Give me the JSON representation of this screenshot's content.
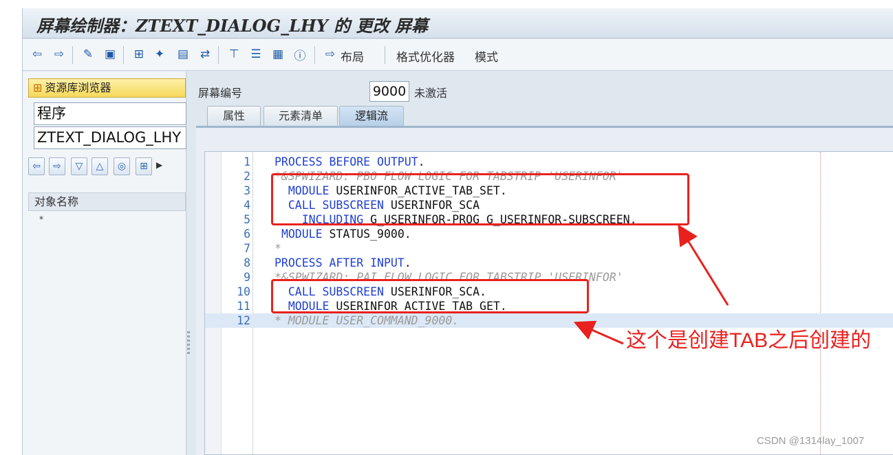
{
  "window": {
    "title": "屏幕绘制器：ZTEXT_DIALOG_LHY 的 更改 屏幕"
  },
  "toolbar": {
    "back_icon": "arrow-left-icon",
    "forward_icon": "arrow-right-icon",
    "layout_label": "布局",
    "format_optimizer_label": "格式优化器",
    "mode_label": "模式"
  },
  "left_pane": {
    "repo_browser_label": "资源库浏览器",
    "object_type": "程序",
    "object_name": "ZTEXT_DIALOG_LHY",
    "object_name_header": "对象名称",
    "tree_placeholder": "*"
  },
  "screen": {
    "number_label": "屏幕编号",
    "number_value": "9000",
    "status": "未激活"
  },
  "tabs": [
    {
      "label": "属性"
    },
    {
      "label": "元素清单"
    },
    {
      "label": "逻辑流"
    }
  ],
  "active_tab": "逻辑流",
  "code": {
    "lines": [
      {
        "n": "1",
        "parts": [
          [
            "kw",
            "PROCESS BEFORE OUTPUT"
          ],
          [
            "pl",
            "."
          ]
        ]
      },
      {
        "n": "2",
        "parts": [
          [
            "cm",
            "*&SPWIZARD: PBO FLOW LOGIC FOR TABSTRIP 'USERINFOR'"
          ]
        ]
      },
      {
        "n": "3",
        "parts": [
          [
            "pl",
            "  "
          ],
          [
            "kw",
            "MODULE"
          ],
          [
            "pl",
            " USERINFOR_ACTIVE_TAB_SET."
          ]
        ]
      },
      {
        "n": "4",
        "parts": [
          [
            "pl",
            "  "
          ],
          [
            "kw",
            "CALL SUBSCREEN"
          ],
          [
            "pl",
            " USERINFOR_SCA"
          ]
        ]
      },
      {
        "n": "5",
        "parts": [
          [
            "pl",
            "    "
          ],
          [
            "kw",
            "INCLUDING"
          ],
          [
            "pl",
            " G_USERINFOR-PROG G_USERINFOR-SUBSCREEN."
          ]
        ]
      },
      {
        "n": "6",
        "parts": [
          [
            "pl",
            " "
          ],
          [
            "kw",
            "MODULE"
          ],
          [
            "pl",
            " STATUS_9000."
          ]
        ]
      },
      {
        "n": "7",
        "parts": [
          [
            "cm",
            "*"
          ]
        ]
      },
      {
        "n": "8",
        "parts": [
          [
            "kw",
            "PROCESS AFTER INPUT"
          ],
          [
            "pl",
            "."
          ]
        ]
      },
      {
        "n": "9",
        "parts": [
          [
            "cm",
            "*&SPWIZARD: PAI FLOW LOGIC FOR TABSTRIP 'USERINFOR'"
          ]
        ]
      },
      {
        "n": "10",
        "parts": [
          [
            "pl",
            "  "
          ],
          [
            "kw",
            "CALL SUBSCREEN"
          ],
          [
            "pl",
            " USERINFOR_SCA."
          ]
        ]
      },
      {
        "n": "11",
        "parts": [
          [
            "pl",
            "  "
          ],
          [
            "kw",
            "MODULE"
          ],
          [
            "pl",
            " USERINFOR_ACTIVE_TAB_GET."
          ]
        ]
      },
      {
        "n": "12",
        "parts": [
          [
            "cm",
            "* MODULE USER_COMMAND_9000."
          ]
        ]
      }
    ],
    "current_line": "12"
  },
  "annotation": {
    "note": "这个是创建TAB之后创建的",
    "color": "#e8211e"
  },
  "watermark": "CSDN @1314lay_1007"
}
